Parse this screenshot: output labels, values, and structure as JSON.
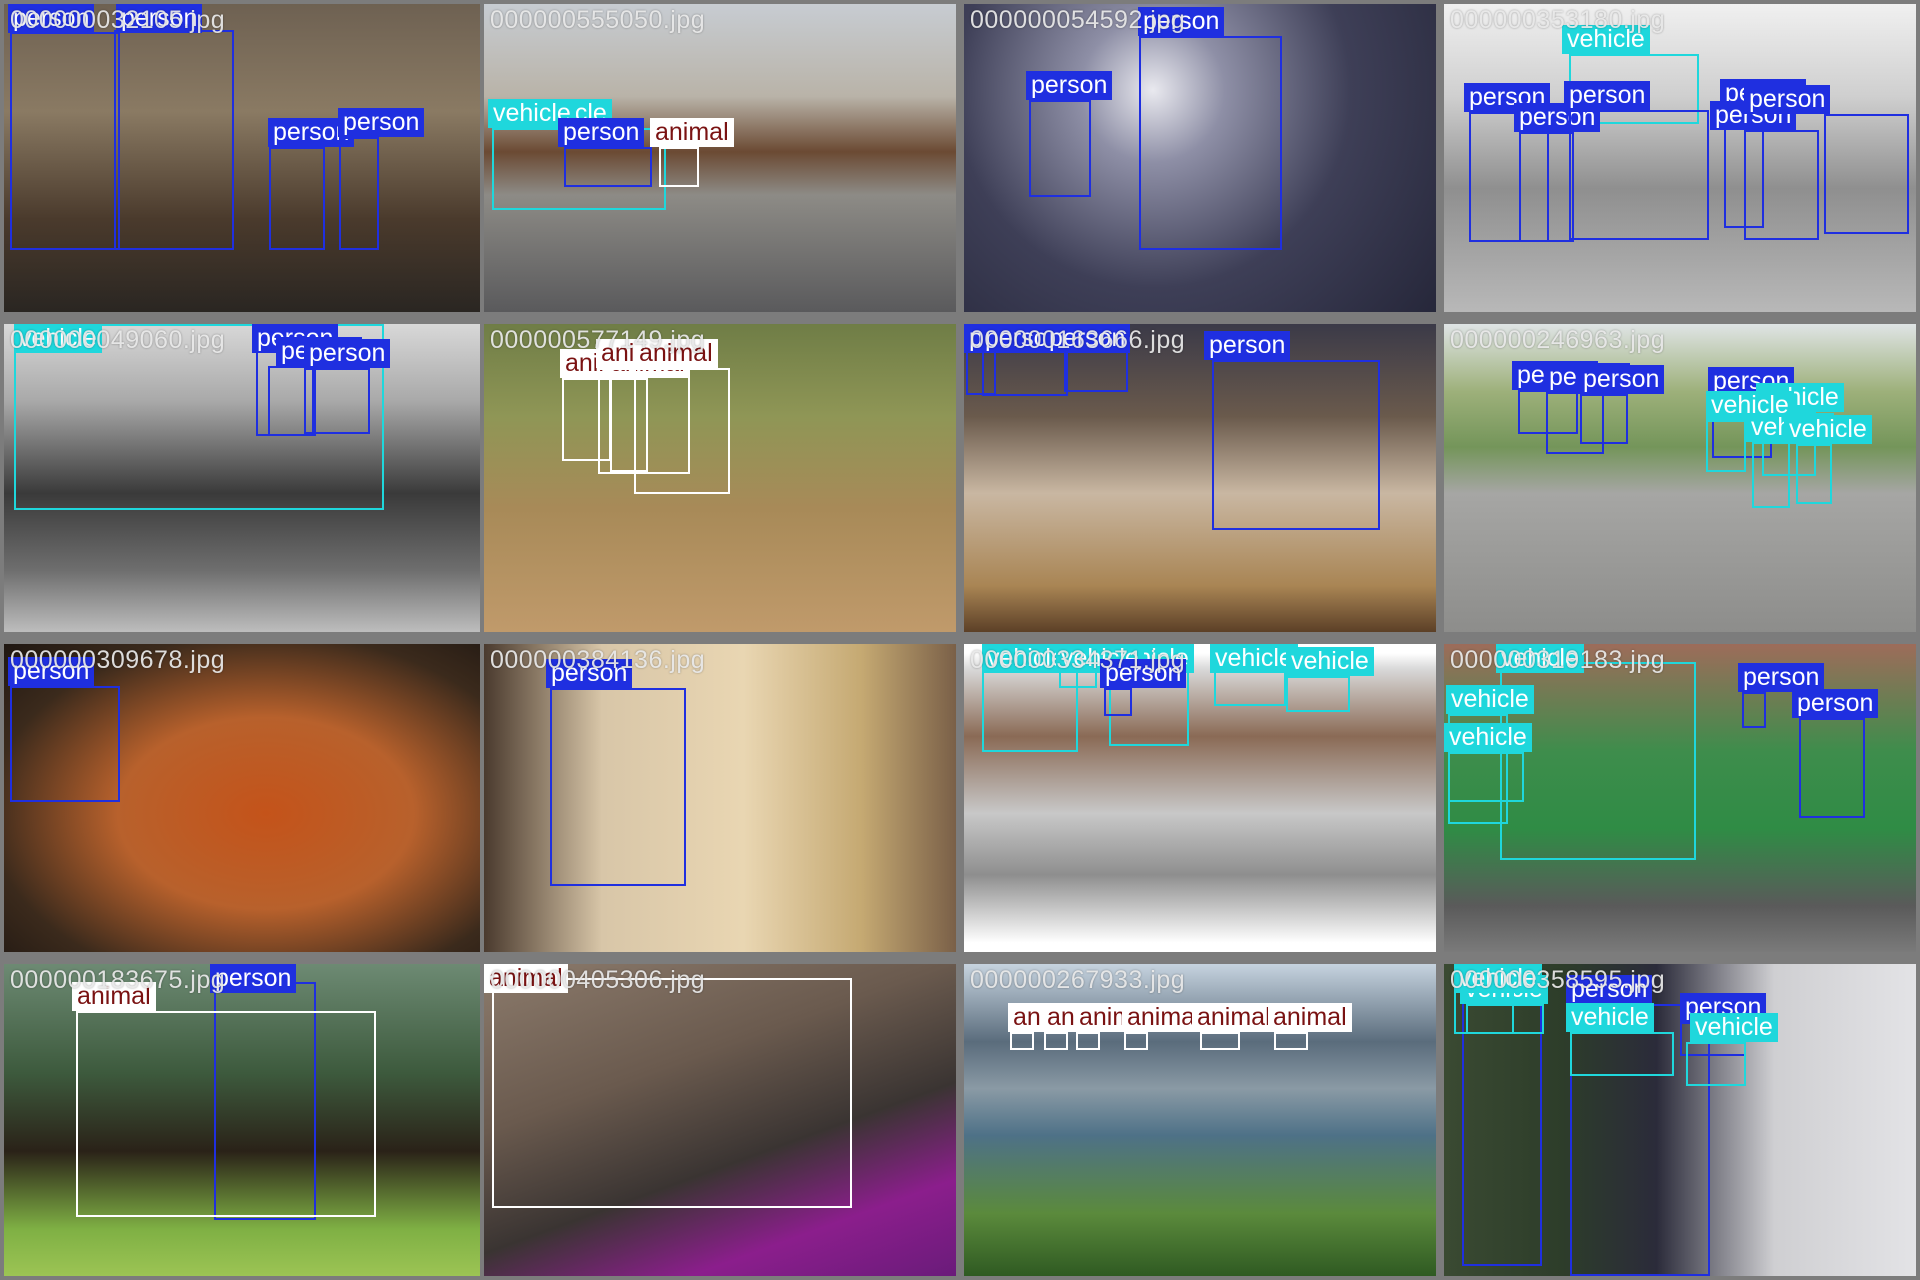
{
  "colors": {
    "person": "#1f2fe0",
    "vehicle": "#1fd7dc",
    "animal": "#ffffff",
    "person_text": "#ffffff",
    "vehicle_text": "#ffffff",
    "animal_text": "#7a1212",
    "grid_bg": "#7c7c7c"
  },
  "tiles": [
    {
      "filename": "000000032105.jpg",
      "detections": [
        {
          "label": "person",
          "cls": "person"
        },
        {
          "label": "person",
          "cls": "person"
        },
        {
          "label": "person",
          "cls": "person"
        },
        {
          "label": "person",
          "cls": "person"
        }
      ]
    },
    {
      "filename": "000000555050.jpg",
      "detections": [
        {
          "label": "vehicle",
          "cls": "vehicle"
        },
        {
          "label": "vehicle",
          "cls": "vehicle"
        },
        {
          "label": "person",
          "cls": "person"
        },
        {
          "label": "animal",
          "cls": "animal"
        }
      ]
    },
    {
      "filename": "000000054592.jpg",
      "detections": [
        {
          "label": "person",
          "cls": "person"
        },
        {
          "label": "person",
          "cls": "person"
        }
      ]
    },
    {
      "filename": "000000353180.jpg",
      "detections": [
        {
          "label": "vehicle",
          "cls": "vehicle"
        },
        {
          "label": "person",
          "cls": "person"
        },
        {
          "label": "person",
          "cls": "person"
        },
        {
          "label": "person",
          "cls": "person"
        },
        {
          "label": "person",
          "cls": "person"
        },
        {
          "label": "person",
          "cls": "person"
        },
        {
          "label": "person",
          "cls": "person"
        }
      ]
    },
    {
      "filename": "000000049060.jpg",
      "detections": [
        {
          "label": "vehicle",
          "cls": "vehicle"
        },
        {
          "label": "person",
          "cls": "person"
        },
        {
          "label": "person",
          "cls": "person"
        },
        {
          "label": "person",
          "cls": "person"
        }
      ]
    },
    {
      "filename": "000000577149.jpg",
      "detections": [
        {
          "label": "animal",
          "cls": "animal"
        },
        {
          "label": "animal",
          "cls": "animal"
        },
        {
          "label": "animal",
          "cls": "animal"
        },
        {
          "label": "animal",
          "cls": "animal"
        }
      ]
    },
    {
      "filename": "000000163666.jpg",
      "detections": [
        {
          "label": "person",
          "cls": "person"
        },
        {
          "label": "person",
          "cls": "person"
        },
        {
          "label": "person",
          "cls": "person"
        },
        {
          "label": "person",
          "cls": "person"
        }
      ]
    },
    {
      "filename": "000000246963.jpg",
      "detections": [
        {
          "label": "person",
          "cls": "person"
        },
        {
          "label": "person",
          "cls": "person"
        },
        {
          "label": "person",
          "cls": "person"
        },
        {
          "label": "person",
          "cls": "person"
        },
        {
          "label": "vehicle",
          "cls": "vehicle"
        },
        {
          "label": "vehicle",
          "cls": "vehicle"
        },
        {
          "label": "vehicle",
          "cls": "vehicle"
        },
        {
          "label": "vehicle",
          "cls": "vehicle"
        }
      ]
    },
    {
      "filename": "000000309678.jpg",
      "detections": [
        {
          "label": "person",
          "cls": "person"
        }
      ]
    },
    {
      "filename": "000000384136.jpg",
      "detections": [
        {
          "label": "person",
          "cls": "person"
        }
      ]
    },
    {
      "filename": "000000334371.jpg",
      "detections": [
        {
          "label": "vehicle",
          "cls": "vehicle"
        },
        {
          "label": "vehicle",
          "cls": "vehicle"
        },
        {
          "label": "vehicle",
          "cls": "vehicle"
        },
        {
          "label": "vehicle",
          "cls": "vehicle"
        },
        {
          "label": "vehicle",
          "cls": "vehicle"
        },
        {
          "label": "person",
          "cls": "person"
        }
      ]
    },
    {
      "filename": "000000319183.jpg",
      "detections": [
        {
          "label": "vehicle",
          "cls": "vehicle"
        },
        {
          "label": "vehicle",
          "cls": "vehicle"
        },
        {
          "label": "vehicle",
          "cls": "vehicle"
        },
        {
          "label": "person",
          "cls": "person"
        },
        {
          "label": "person",
          "cls": "person"
        }
      ]
    },
    {
      "filename": "000000183675.jpg",
      "detections": [
        {
          "label": "person",
          "cls": "person"
        },
        {
          "label": "animal",
          "cls": "animal"
        }
      ]
    },
    {
      "filename": "000000405306.jpg",
      "detections": [
        {
          "label": "animal",
          "cls": "animal"
        }
      ]
    },
    {
      "filename": "000000267933.jpg",
      "detections": [
        {
          "label": "animal",
          "cls": "animal"
        },
        {
          "label": "animal",
          "cls": "animal"
        },
        {
          "label": "animal",
          "cls": "animal"
        },
        {
          "label": "animal",
          "cls": "animal"
        },
        {
          "label": "animal",
          "cls": "animal"
        },
        {
          "label": "animal",
          "cls": "animal"
        }
      ]
    },
    {
      "filename": "000000358595.jpg",
      "detections": [
        {
          "label": "person",
          "cls": "person"
        },
        {
          "label": "vehicle",
          "cls": "vehicle"
        },
        {
          "label": "person",
          "cls": "person"
        },
        {
          "label": "vehicle",
          "cls": "vehicle"
        },
        {
          "label": "person",
          "cls": "person"
        },
        {
          "label": "vehicle",
          "cls": "vehicle"
        },
        {
          "label": "vehicle",
          "cls": "vehicle"
        }
      ]
    }
  ]
}
